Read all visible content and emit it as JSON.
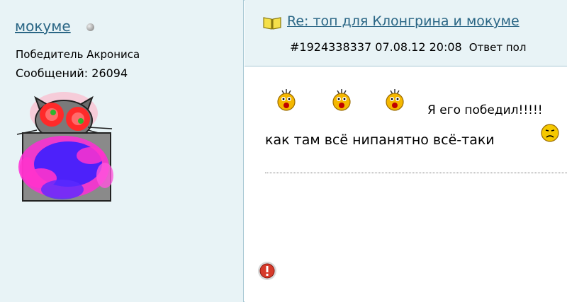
{
  "user": {
    "name": "мокуме",
    "rank": "Победитель Акрониса",
    "messages": "Сообщений: 26094"
  },
  "post": {
    "title": "Re: топ для Клонгрина и мокуме",
    "meta": "#1924338337 07.08.12 20:08",
    "reply_label": "Ответ пол",
    "line1": "Я его победил!!!!!",
    "line2": "как там всё нипанятно всё-таки"
  },
  "icons": {
    "status": "offline-status-icon",
    "title": "open-book-icon",
    "smileys": "crying-smiley-icon",
    "sad": "sad-smiley-icon",
    "warn": "report-warning-icon"
  },
  "colors": {
    "panel_bg": "#e8f3f6",
    "border": "#a9c9d4",
    "link": "#2a6685"
  }
}
